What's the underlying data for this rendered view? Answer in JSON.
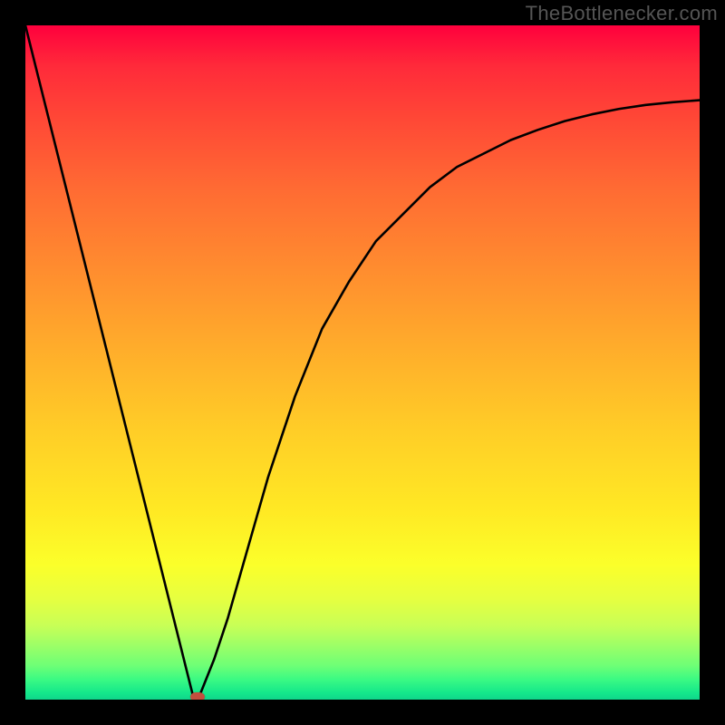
{
  "watermark": "TheBottlenecker.com",
  "colors": {
    "frame": "#000000",
    "curve": "#000000",
    "marker": "#c44f3e",
    "gradient_top": "#ff003d",
    "gradient_bottom": "#10d58b"
  },
  "chart_data": {
    "type": "line",
    "title": "",
    "xlabel": "",
    "ylabel": "",
    "xlim": [
      0,
      100
    ],
    "ylim": [
      0,
      100
    ],
    "grid": false,
    "legend": false,
    "background": "red-to-green vertical gradient (bottleneck severity)",
    "series": [
      {
        "name": "bottleneck-curve",
        "x": [
          0,
          2,
          4,
          6,
          8,
          10,
          12,
          14,
          16,
          18,
          20,
          22,
          24,
          25,
          26,
          28,
          30,
          32,
          34,
          36,
          38,
          40,
          44,
          48,
          52,
          56,
          60,
          64,
          68,
          72,
          76,
          80,
          84,
          88,
          92,
          96,
          100
        ],
        "y": [
          100,
          92,
          84,
          76,
          68,
          60,
          52,
          44,
          36,
          28,
          20,
          12,
          4,
          0,
          1,
          6,
          12,
          19,
          26,
          33,
          39,
          45,
          55,
          62,
          68,
          72,
          76,
          79,
          81,
          83,
          84.5,
          85.8,
          86.8,
          87.6,
          88.2,
          88.6,
          88.9
        ]
      }
    ],
    "marker": {
      "x": 25.5,
      "y": 0,
      "description": "optimal point (no bottleneck)"
    },
    "annotations": [
      {
        "text": "TheBottlenecker.com",
        "position": "top-right"
      }
    ]
  }
}
